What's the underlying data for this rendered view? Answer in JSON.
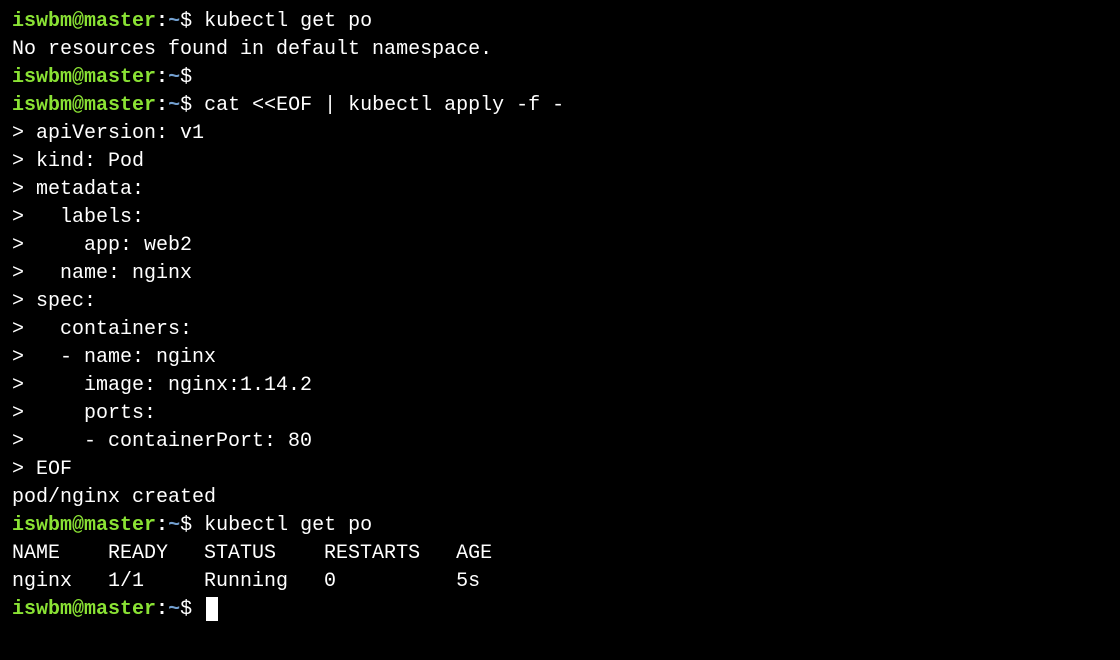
{
  "prompt": {
    "user": "iswbm",
    "at": "@",
    "host": "master",
    "colon": ":",
    "path": "~",
    "dollar": "$"
  },
  "lines": {
    "cmd1": "kubectl get po",
    "out1": "No resources found in default namespace.",
    "cmd2_blank": "",
    "cmd3": "cat <<EOF | kubectl apply -f -",
    "heredoc": [
      "> apiVersion: v1",
      "> kind: Pod",
      "> metadata:",
      ">   labels:",
      ">     app: web2",
      ">   name: nginx",
      "> spec:",
      ">   containers:",
      ">   - name: nginx",
      ">     image: nginx:1.14.2",
      ">     ports:",
      ">     - containerPort: 80",
      "> EOF"
    ],
    "out2": "pod/nginx created",
    "cmd4": "kubectl get po",
    "table_header": "NAME    READY   STATUS    RESTARTS   AGE",
    "table_row1": "nginx   1/1     Running   0          5s"
  },
  "table": {
    "headers": [
      "NAME",
      "READY",
      "STATUS",
      "RESTARTS",
      "AGE"
    ],
    "rows": [
      {
        "NAME": "nginx",
        "READY": "1/1",
        "STATUS": "Running",
        "RESTARTS": "0",
        "AGE": "5s"
      }
    ]
  }
}
